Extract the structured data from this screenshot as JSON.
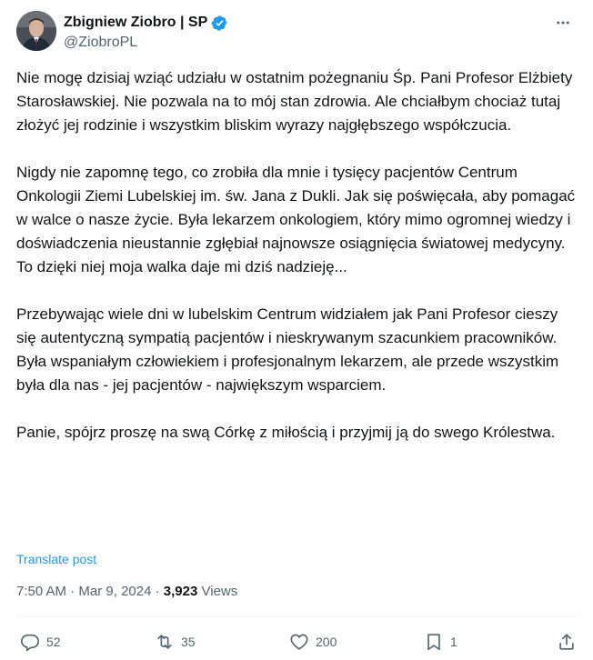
{
  "author": {
    "display_name": "Zbigniew Ziobro | SP",
    "handle": "@ZiobroPL",
    "verified_color": "#1d9bf0"
  },
  "post": {
    "paragraphs": [
      "Nie mogę dzisiaj wziąć udziału w ostatnim pożegnaniu Śp. Pani Profesor Elżbiety Starosławskiej. Nie pozwala na to mój stan zdrowia. Ale chciałbym chociaż tutaj złożyć jej rodzinie i wszystkim bliskim wyrazy najgłębszego współczucia.",
      "Nigdy nie zapomnę tego, co zrobiła dla mnie i tysięcy pacjentów Centrum Onkologii Ziemi Lubelskiej im. św. Jana z Dukli. Jak się poświęcała, aby pomagać w walce o nasze życie. Była lekarzem onkologiem, który mimo ogromnej wiedzy i doświadczenia nieustannie zgłębiał najnowsze osiągnięcia światowej medycyny. To dzięki niej moja walka daje mi dziś nadzieję...",
      "Przebywając wiele dni w lubelskim Centrum widziałem jak Pani Profesor cieszy się autentyczną sympatią pacjentów i nieskrywanym szacunkiem pracowników. Była wspaniałym człowiekiem i profesjonalnym lekarzem, ale przede wszystkim była dla nas - jej pacjentów - największym wsparciem.",
      "Panie, spójrz proszę na swą Córkę z miłością i przyjmij ją do swego Królestwa."
    ],
    "translate_label": "Translate post",
    "time": "7:50 AM",
    "separator": "·",
    "date": "Mar 9, 2024",
    "views_count": "3,923",
    "views_label": "Views"
  },
  "actions": {
    "replies": "52",
    "reposts": "35",
    "likes": "200",
    "bookmarks": "1"
  },
  "icons": {
    "more": "more-horizontal-icon",
    "verified": "verified-badge-icon",
    "reply": "reply-icon",
    "repost": "repost-icon",
    "like": "heart-icon",
    "bookmark": "bookmark-icon",
    "share": "share-icon"
  },
  "colors": {
    "text": "#0f1419",
    "secondary": "#536471",
    "link": "#1d9bf0",
    "divider": "#eff3f4"
  }
}
